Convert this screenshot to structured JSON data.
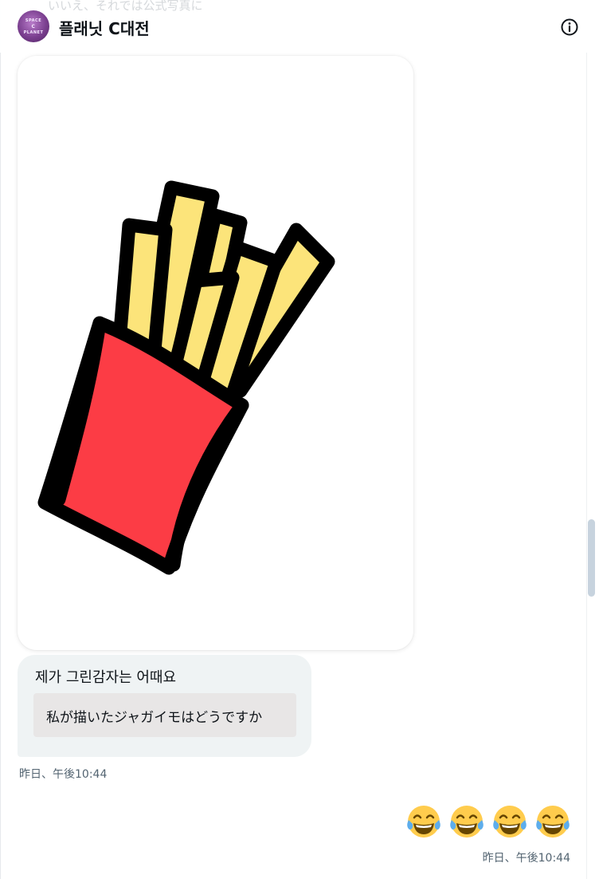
{
  "header": {
    "title": "플래닛 C대전",
    "ghost_text": "いいえ、それでは公式写真に",
    "avatar_logo": [
      "SPACE",
      "C",
      "PLANET"
    ],
    "info_icon": "info-icon"
  },
  "messages": [
    {
      "type": "image",
      "image_icon": "french-fries-drawing",
      "colors": {
        "fries": "#fce47a",
        "carton": "#fc3c45",
        "outline": "#000000"
      }
    },
    {
      "type": "text",
      "text": "제가 그린감자는 어때요",
      "translation": "私が描いたジャガイモはどうですか",
      "timestamp": "昨日、午後10:44"
    },
    {
      "type": "emoji",
      "emojis": [
        "😂",
        "😂",
        "😂",
        "😂"
      ],
      "emoji_icon": "face-with-tears-of-joy-icon",
      "timestamp": "昨日、午後10:44"
    }
  ],
  "colors": {
    "bubble_bg": "#eff3f4",
    "translation_bg": "#e8e6e6",
    "timestamp": "#536471",
    "scroll_thumb": "#c7d3de"
  }
}
